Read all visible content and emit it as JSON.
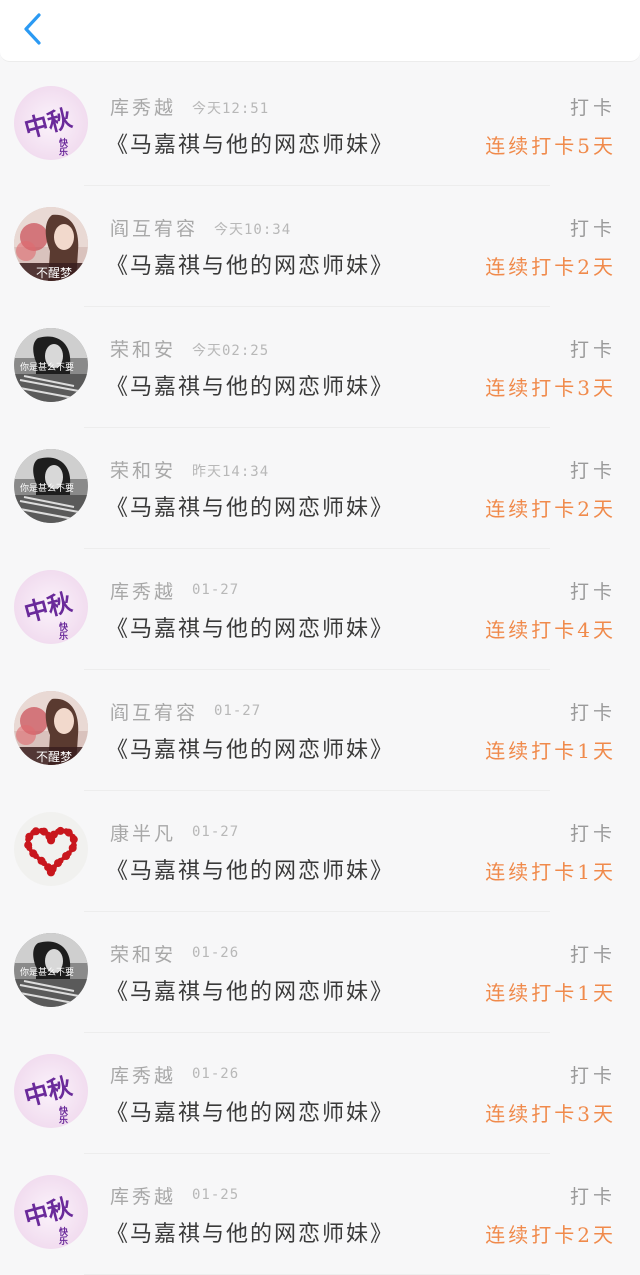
{
  "colors": {
    "accent": "#2b9af3",
    "streak": "#f08a4b"
  },
  "header": {
    "back_icon": "chevron-left-icon"
  },
  "items": [
    {
      "name": "库秀越",
      "time": "今天12:51",
      "action": "打卡",
      "book": "《马嘉祺与他的网恋师妹》",
      "streak": "连续打卡5天",
      "avatar": "mid-autumn"
    },
    {
      "name": "阎互宥容",
      "time": "今天10:34",
      "action": "打卡",
      "book": "《马嘉祺与他的网恋师妹》",
      "streak": "连续打卡2天",
      "avatar": "girl-photo"
    },
    {
      "name": "荣和安",
      "time": "今天02:25",
      "action": "打卡",
      "book": "《马嘉祺与他的网恋师妹》",
      "streak": "连续打卡3天",
      "avatar": "bw-photo"
    },
    {
      "name": "荣和安",
      "time": "昨天14:34",
      "action": "打卡",
      "book": "《马嘉祺与他的网恋师妹》",
      "streak": "连续打卡2天",
      "avatar": "bw-photo"
    },
    {
      "name": "库秀越",
      "time": "01-27",
      "action": "打卡",
      "book": "《马嘉祺与他的网恋师妹》",
      "streak": "连续打卡4天",
      "avatar": "mid-autumn"
    },
    {
      "name": "阎互宥容",
      "time": "01-27",
      "action": "打卡",
      "book": "《马嘉祺与他的网恋师妹》",
      "streak": "连续打卡1天",
      "avatar": "girl-photo"
    },
    {
      "name": "康半凡",
      "time": "01-27",
      "action": "打卡",
      "book": "《马嘉祺与他的网恋师妹》",
      "streak": "连续打卡1天",
      "avatar": "heart"
    },
    {
      "name": "荣和安",
      "time": "01-26",
      "action": "打卡",
      "book": "《马嘉祺与他的网恋师妹》",
      "streak": "连续打卡1天",
      "avatar": "bw-photo"
    },
    {
      "name": "库秀越",
      "time": "01-26",
      "action": "打卡",
      "book": "《马嘉祺与他的网恋师妹》",
      "streak": "连续打卡3天",
      "avatar": "mid-autumn"
    },
    {
      "name": "库秀越",
      "time": "01-25",
      "action": "打卡",
      "book": "《马嘉祺与他的网恋师妹》",
      "streak": "连续打卡2天",
      "avatar": "mid-autumn"
    }
  ],
  "avatar_texts": {
    "mid_autumn": {
      "big": "中秋",
      "small": "快乐"
    },
    "girl_caption": "不醒梦",
    "bw_caption": "你是甚么不要"
  }
}
